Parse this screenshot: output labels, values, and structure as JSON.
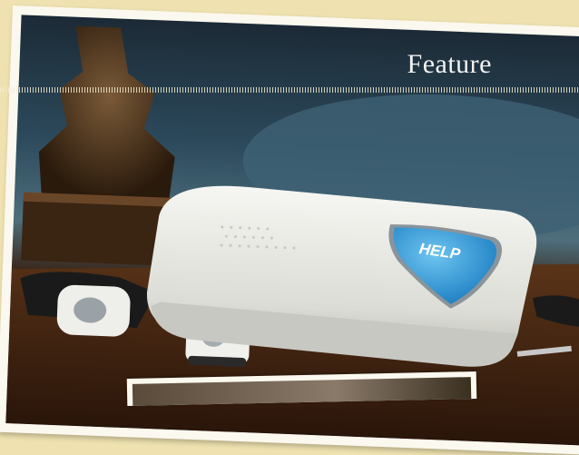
{
  "header": {
    "section_title": "Feature"
  },
  "device": {
    "button_label": "HELP"
  },
  "colors": {
    "background": "#efe2b0",
    "frame": "#fbf8ef",
    "help_button": "#2a9ad8",
    "device_body": "#ecece8"
  }
}
